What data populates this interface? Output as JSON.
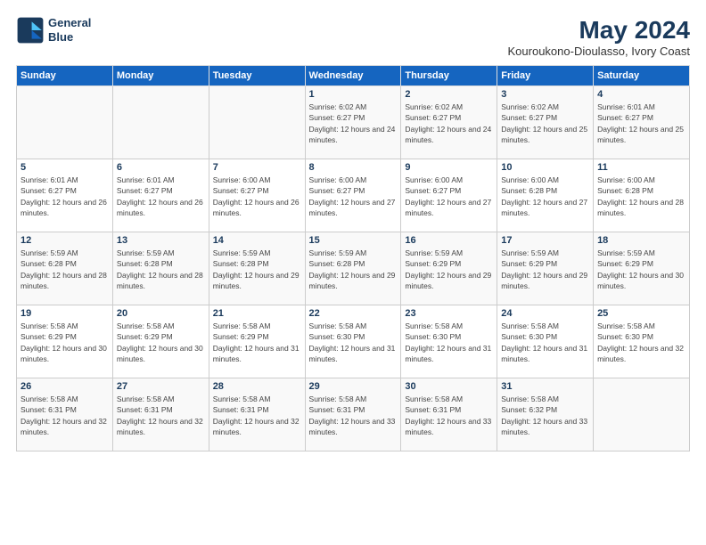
{
  "logo": {
    "line1": "General",
    "line2": "Blue"
  },
  "title": "May 2024",
  "subtitle": "Kouroukono-Dioulasso, Ivory Coast",
  "days_header": [
    "Sunday",
    "Monday",
    "Tuesday",
    "Wednesday",
    "Thursday",
    "Friday",
    "Saturday"
  ],
  "weeks": [
    [
      {
        "day": "",
        "text": ""
      },
      {
        "day": "",
        "text": ""
      },
      {
        "day": "",
        "text": ""
      },
      {
        "day": "1",
        "text": "Sunrise: 6:02 AM\nSunset: 6:27 PM\nDaylight: 12 hours and 24 minutes."
      },
      {
        "day": "2",
        "text": "Sunrise: 6:02 AM\nSunset: 6:27 PM\nDaylight: 12 hours and 24 minutes."
      },
      {
        "day": "3",
        "text": "Sunrise: 6:02 AM\nSunset: 6:27 PM\nDaylight: 12 hours and 25 minutes."
      },
      {
        "day": "4",
        "text": "Sunrise: 6:01 AM\nSunset: 6:27 PM\nDaylight: 12 hours and 25 minutes."
      }
    ],
    [
      {
        "day": "5",
        "text": "Sunrise: 6:01 AM\nSunset: 6:27 PM\nDaylight: 12 hours and 26 minutes."
      },
      {
        "day": "6",
        "text": "Sunrise: 6:01 AM\nSunset: 6:27 PM\nDaylight: 12 hours and 26 minutes."
      },
      {
        "day": "7",
        "text": "Sunrise: 6:00 AM\nSunset: 6:27 PM\nDaylight: 12 hours and 26 minutes."
      },
      {
        "day": "8",
        "text": "Sunrise: 6:00 AM\nSunset: 6:27 PM\nDaylight: 12 hours and 27 minutes."
      },
      {
        "day": "9",
        "text": "Sunrise: 6:00 AM\nSunset: 6:27 PM\nDaylight: 12 hours and 27 minutes."
      },
      {
        "day": "10",
        "text": "Sunrise: 6:00 AM\nSunset: 6:28 PM\nDaylight: 12 hours and 27 minutes."
      },
      {
        "day": "11",
        "text": "Sunrise: 6:00 AM\nSunset: 6:28 PM\nDaylight: 12 hours and 28 minutes."
      }
    ],
    [
      {
        "day": "12",
        "text": "Sunrise: 5:59 AM\nSunset: 6:28 PM\nDaylight: 12 hours and 28 minutes."
      },
      {
        "day": "13",
        "text": "Sunrise: 5:59 AM\nSunset: 6:28 PM\nDaylight: 12 hours and 28 minutes."
      },
      {
        "day": "14",
        "text": "Sunrise: 5:59 AM\nSunset: 6:28 PM\nDaylight: 12 hours and 29 minutes."
      },
      {
        "day": "15",
        "text": "Sunrise: 5:59 AM\nSunset: 6:28 PM\nDaylight: 12 hours and 29 minutes."
      },
      {
        "day": "16",
        "text": "Sunrise: 5:59 AM\nSunset: 6:29 PM\nDaylight: 12 hours and 29 minutes."
      },
      {
        "day": "17",
        "text": "Sunrise: 5:59 AM\nSunset: 6:29 PM\nDaylight: 12 hours and 29 minutes."
      },
      {
        "day": "18",
        "text": "Sunrise: 5:59 AM\nSunset: 6:29 PM\nDaylight: 12 hours and 30 minutes."
      }
    ],
    [
      {
        "day": "19",
        "text": "Sunrise: 5:58 AM\nSunset: 6:29 PM\nDaylight: 12 hours and 30 minutes."
      },
      {
        "day": "20",
        "text": "Sunrise: 5:58 AM\nSunset: 6:29 PM\nDaylight: 12 hours and 30 minutes."
      },
      {
        "day": "21",
        "text": "Sunrise: 5:58 AM\nSunset: 6:29 PM\nDaylight: 12 hours and 31 minutes."
      },
      {
        "day": "22",
        "text": "Sunrise: 5:58 AM\nSunset: 6:30 PM\nDaylight: 12 hours and 31 minutes."
      },
      {
        "day": "23",
        "text": "Sunrise: 5:58 AM\nSunset: 6:30 PM\nDaylight: 12 hours and 31 minutes."
      },
      {
        "day": "24",
        "text": "Sunrise: 5:58 AM\nSunset: 6:30 PM\nDaylight: 12 hours and 31 minutes."
      },
      {
        "day": "25",
        "text": "Sunrise: 5:58 AM\nSunset: 6:30 PM\nDaylight: 12 hours and 32 minutes."
      }
    ],
    [
      {
        "day": "26",
        "text": "Sunrise: 5:58 AM\nSunset: 6:31 PM\nDaylight: 12 hours and 32 minutes."
      },
      {
        "day": "27",
        "text": "Sunrise: 5:58 AM\nSunset: 6:31 PM\nDaylight: 12 hours and 32 minutes."
      },
      {
        "day": "28",
        "text": "Sunrise: 5:58 AM\nSunset: 6:31 PM\nDaylight: 12 hours and 32 minutes."
      },
      {
        "day": "29",
        "text": "Sunrise: 5:58 AM\nSunset: 6:31 PM\nDaylight: 12 hours and 33 minutes."
      },
      {
        "day": "30",
        "text": "Sunrise: 5:58 AM\nSunset: 6:31 PM\nDaylight: 12 hours and 33 minutes."
      },
      {
        "day": "31",
        "text": "Sunrise: 5:58 AM\nSunset: 6:32 PM\nDaylight: 12 hours and 33 minutes."
      },
      {
        "day": "",
        "text": ""
      }
    ]
  ]
}
